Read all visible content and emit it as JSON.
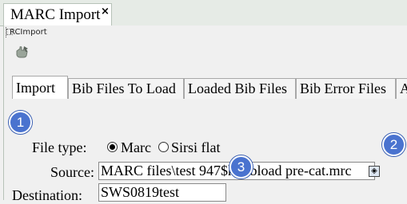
{
  "window": {
    "tab_title": "MARC Import",
    "tab_close_glyph": "×"
  },
  "panel": {
    "label": "RCImport",
    "toolbar_icon": "pointer-hand-icon"
  },
  "tabs": [
    {
      "label": "Import",
      "active": true
    },
    {
      "label": "Bib Files To Load",
      "active": false
    },
    {
      "label": "Loaded Bib Files",
      "active": false
    },
    {
      "label": "Bib Error Files",
      "active": false
    },
    {
      "label": "A",
      "active": false
    }
  ],
  "form": {
    "file_type": {
      "label": "File type:",
      "options": [
        {
          "label": "Marc",
          "selected": true
        },
        {
          "label": "Sirsi flat",
          "selected": false
        }
      ]
    },
    "source": {
      "label": "Source:",
      "value": "MARC files\\test 947$h bibload pre-cat.mrc",
      "browse_glyph": "◈"
    },
    "destination": {
      "label": "Destination:",
      "value": "SWS0819test"
    }
  },
  "callouts": [
    "1",
    "2",
    "3"
  ],
  "colors": {
    "callout": "#4a73cf",
    "tab_strip": "#e6ebe6"
  }
}
